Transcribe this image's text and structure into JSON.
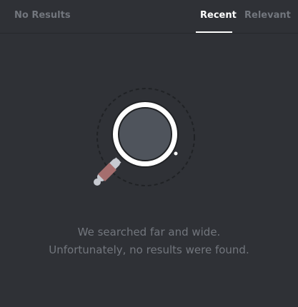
{
  "header": {
    "title": "No Results",
    "tabs": [
      {
        "label": "Recent",
        "active": true
      },
      {
        "label": "Relevant",
        "active": false
      }
    ]
  },
  "empty_state": {
    "icon": "magnifying-glass-icon",
    "line1": "We searched far and wide.",
    "line2": "Unfortunately, no results were found."
  },
  "colors": {
    "background": "#2f3136",
    "active_tab": "#ffffff",
    "muted_text": "#72767d",
    "lens_fill": "#4f545c",
    "handle": "#a56e6e"
  }
}
